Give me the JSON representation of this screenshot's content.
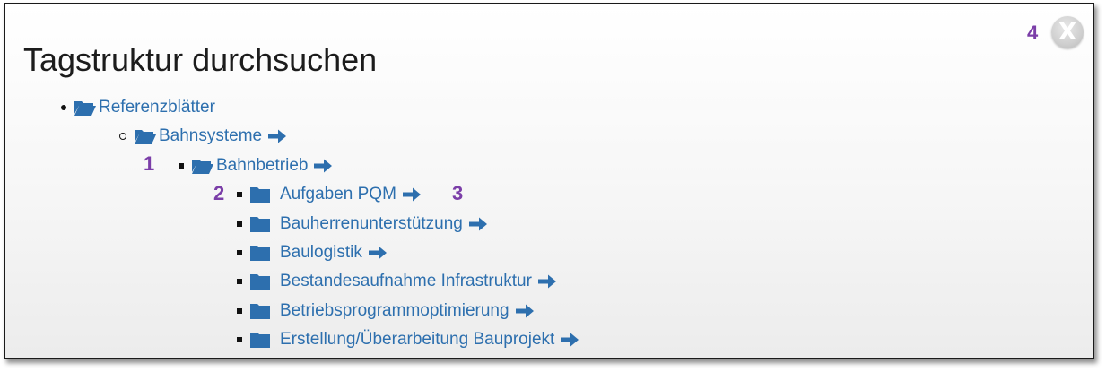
{
  "dialog": {
    "title": "Tagstruktur durchsuchen",
    "close_label": "X"
  },
  "callouts": [
    "1",
    "2",
    "3",
    "4"
  ],
  "tree": [
    {
      "label": "Referenzblätter",
      "level": 0,
      "bullet": "disc",
      "folder": "open",
      "arrow": false
    },
    {
      "label": "Bahnsysteme",
      "level": 1,
      "bullet": "circle",
      "folder": "open",
      "arrow": true
    },
    {
      "label": "Bahnbetrieb",
      "level": 2,
      "bullet": "square",
      "folder": "open",
      "arrow": true
    },
    {
      "label": "Aufgaben PQM",
      "level": 3,
      "bullet": "square",
      "folder": "closed",
      "arrow": true
    },
    {
      "label": "Bauherrenunterstützung",
      "level": 3,
      "bullet": "square",
      "folder": "closed",
      "arrow": true
    },
    {
      "label": "Baulogistik",
      "level": 3,
      "bullet": "square",
      "folder": "closed",
      "arrow": true
    },
    {
      "label": "Bestandesaufnahme Infrastruktur",
      "level": 3,
      "bullet": "square",
      "folder": "closed",
      "arrow": true
    },
    {
      "label": "Betriebsprogrammoptimierung",
      "level": 3,
      "bullet": "square",
      "folder": "closed",
      "arrow": true
    },
    {
      "label": "Erstellung/Überarbeitung Bauprojekt",
      "level": 3,
      "bullet": "square",
      "folder": "closed",
      "arrow": true
    }
  ],
  "colors": {
    "link": "#2d6fae",
    "callout": "#7b3ea8",
    "border": "#1a1a1a"
  },
  "icons": {
    "open_folder": "folder-open-icon",
    "closed_folder": "folder-icon",
    "arrow": "arrow-right-icon"
  }
}
